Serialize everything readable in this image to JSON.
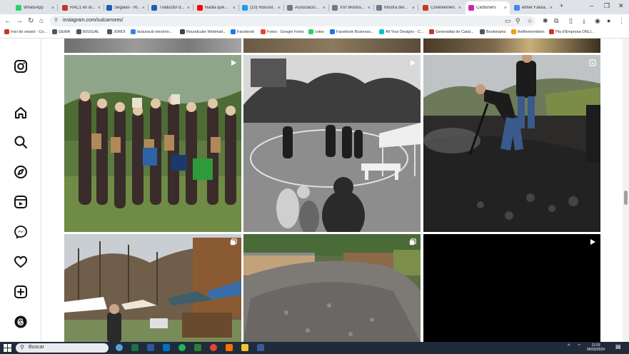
{
  "browser": {
    "tabs": [
      {
        "title": "WhatsApp",
        "color": "#25d366"
      },
      {
        "title": "RAC1 en di...",
        "color": "#c0392b"
      },
      {
        "title": "Segalas - Ri...",
        "color": "#1a5fb4"
      },
      {
        "title": "Traductor d...",
        "color": "#1a5fb4"
      },
      {
        "title": "Nadia que...",
        "color": "#ff0000"
      },
      {
        "title": "(10) Roussil...",
        "color": "#1d9bf0"
      },
      {
        "title": "Associació...",
        "color": "#6c7a89"
      },
      {
        "title": "XVI Mostra...",
        "color": "#6c7a89"
      },
      {
        "title": "Mostra del...",
        "color": "#6c7a89"
      },
      {
        "title": "Coneixemen...",
        "color": "#c0392b"
      },
      {
        "title": "Carboners",
        "color": "#d6249f"
      },
      {
        "title": "elmer Falsia...",
        "color": "#4285f4"
      }
    ],
    "new_tab": "+",
    "url": "instagram.com/sulcarrores/",
    "bookmarks": [
      {
        "label": "Inici de sessió - Co...",
        "color": "#c0392b"
      },
      {
        "label": "GEMA",
        "color": "#555555"
      },
      {
        "label": "BISSUAL",
        "color": "#555555"
      },
      {
        "label": "JORDI",
        "color": "#555555"
      },
      {
        "label": "facturació electròn...",
        "color": "#2e86de"
      },
      {
        "label": "Roundcube Webmail...",
        "color": "#37474f"
      },
      {
        "label": "Facebook",
        "color": "#1877f2"
      },
      {
        "label": "Fotos - Google Fotos",
        "color": "#ea4335"
      },
      {
        "label": "cotes",
        "color": "#25d366"
      },
      {
        "label": "Facebook Business...",
        "color": "#1877f2"
      },
      {
        "label": "All Your Designs - C...",
        "color": "#00c4cc"
      },
      {
        "label": "Generalitat de Catal...",
        "color": "#c0392b"
      },
      {
        "label": "Bookmarks",
        "color": "#555555"
      },
      {
        "label": "theRemembers",
        "color": "#f39c12"
      },
      {
        "label": "Pla d'Empresa ONLI...",
        "color": "#c0392b"
      }
    ]
  },
  "sidebar": {
    "items": [
      {
        "name": "instagram-logo-icon"
      },
      {
        "name": "home-icon"
      },
      {
        "name": "search-icon"
      },
      {
        "name": "explore-icon"
      },
      {
        "name": "reels-icon"
      },
      {
        "name": "messenger-icon"
      },
      {
        "name": "notifications-heart-icon"
      },
      {
        "name": "create-icon"
      },
      {
        "name": "threads-icon"
      }
    ]
  },
  "grid": {
    "posts": [
      {
        "description": "Group of accordion musicians in a field",
        "badge": "reel-icon"
      },
      {
        "description": "Black and white: dancers in traditional costume in a circle",
        "badge": "reel-icon"
      },
      {
        "description": "Men shoveling charcoal on a smoking charcoal kiln",
        "badge": "reel-icon"
      },
      {
        "description": "Outdoor fair with tents and market stalls",
        "badge": "carousel-icon"
      },
      {
        "description": "Covered charcoal mound in front of wooden houses",
        "badge": "carousel-icon"
      },
      {
        "description": "Black video frame",
        "badge": "reel-icon"
      }
    ]
  },
  "taskbar": {
    "search_label": "Buscar",
    "time": "11:53",
    "date": "06/03/2024"
  }
}
